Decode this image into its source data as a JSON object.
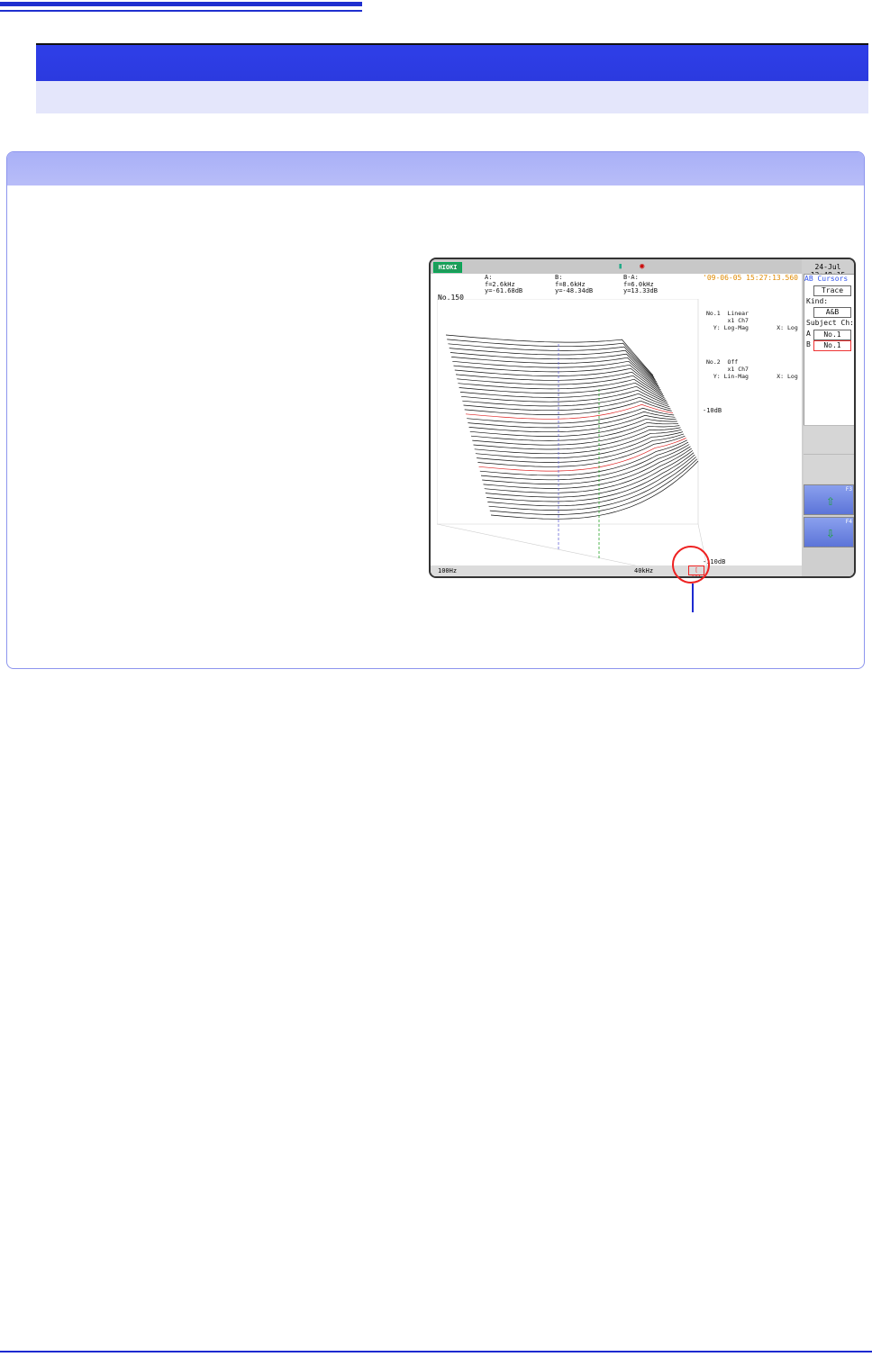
{
  "screen": {
    "brand": "HIOKI",
    "clock": "24-Jul 13:48:15",
    "timestamp": "'09-06-05 15:27:13.560",
    "record_no": "No.150",
    "cursor_a": "A:\nf=2.6kHz\ny=-61.68dB",
    "cursor_b": "B:\nf=8.6kHz\ny=-48.34dB",
    "cursor_diff": "B-A:\nf=6.0kHz\ny=13.33dB",
    "ch1_legend": "No.1  Linear\n      x1 Ch7\n  Y: Log-Mag        X: Log",
    "ch2_legend": "No.2  Off\n      x1 Ch7\n  Y: Lin-Mag        X: Log",
    "scale_top": "-10dB",
    "scale_bottom": "-110dB",
    "x_start": "100Hz",
    "x_end": "40kHz",
    "chip": "[ 25]",
    "side": {
      "header": "AB Cursors",
      "trace_label": "Trace",
      "kind_label": "Kind:",
      "kind_value": "A&B",
      "subject_label": "Subject Ch:",
      "a_label": "A",
      "a_value": "No.1",
      "b_label": "B",
      "b_value": "No.1",
      "btn1_key": "F3",
      "btn2_key": "F4"
    }
  }
}
